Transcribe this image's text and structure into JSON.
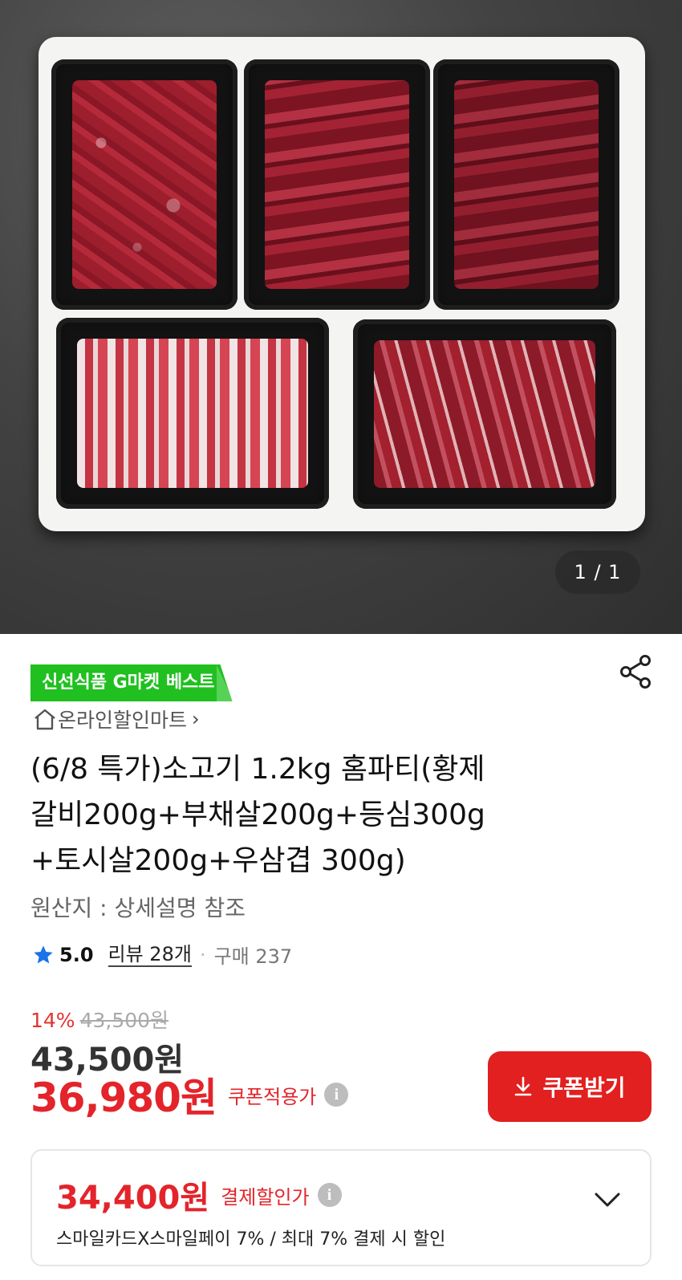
{
  "gallery": {
    "counter": "1 / 1"
  },
  "product": {
    "badge": "신선식품 G마켓 베스트",
    "shop_name": "온라인할인마트",
    "shop_chevron": "›",
    "title_lines": [
      "(6/8 특가)소고기 1.2kg 홈파티(황제",
      "갈비200g+부채살200g+등심300g",
      "+토시살200g+우삼겹 300g)"
    ],
    "origin": "원산지 : 상세설명 참조",
    "rating": "5.0",
    "reviews": "리뷰 28개",
    "separator": "·",
    "sold": "구매 237"
  },
  "pricing": {
    "discount_pct": "14%",
    "original_price": "43,500원",
    "price": "43,500원",
    "coupon_price": "36,980원",
    "coupon_price_label": "쿠폰적용가",
    "coupon_button": "쿠폰받기",
    "card_price": "34,400원",
    "card_price_label": "결제할인가",
    "card_desc": "스마일카드X스마일페이 7% / 최대 7% 결제 시 할인"
  },
  "icons": {
    "share": "share-icon",
    "home": "home-icon",
    "star": "star-icon",
    "info": "info-icon",
    "download": "download-icon",
    "chevron_down": "chevron-down-icon"
  },
  "colors": {
    "accent_red": "#e1201f",
    "badge_green": "#20c020",
    "star_blue": "#1a73e8"
  }
}
